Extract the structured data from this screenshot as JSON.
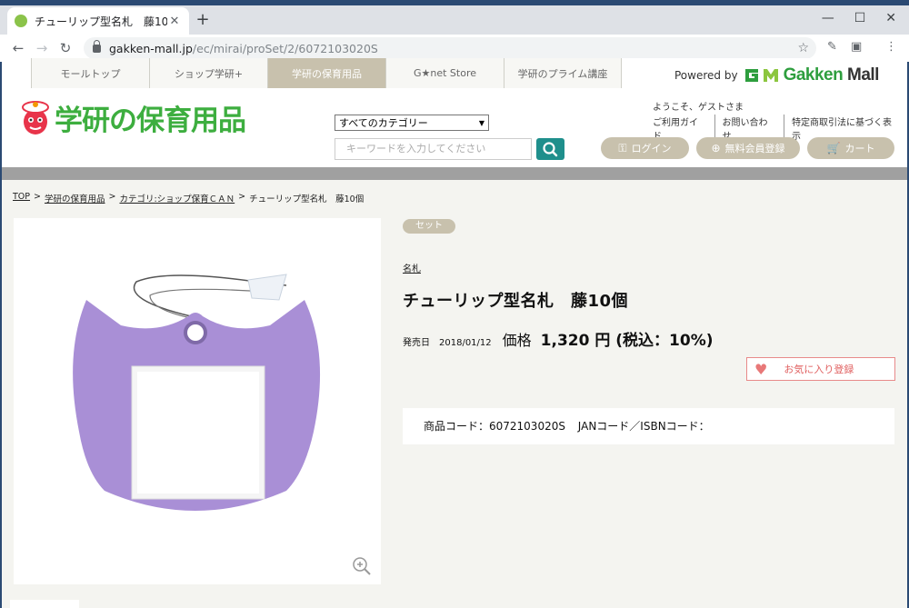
{
  "browser": {
    "tab_title": "チューリップ型名札　藤10個",
    "tab_close": "✕",
    "new_tab": "+",
    "url_host": "gakken-mall.jp",
    "url_path": "/ec/mirai/proSet/2/6072103020S",
    "controls": {
      "minimize": "—",
      "maximize": "☐",
      "close": "✕"
    }
  },
  "topnav": {
    "tabs": [
      "モールトップ",
      "ショップ学研+",
      "学研の保育用品",
      "G★net Store",
      "学研のプライム講座"
    ],
    "active_index": 2,
    "powered_by": "Powered by",
    "brand_gakken": "Gakken",
    "brand_mall": "Mall"
  },
  "header": {
    "logo_text": "学研の保育用品",
    "category_select": "すべてのカテゴリー",
    "search_placeholder": "キーワードを入力してください",
    "greeting": "ようこそ、ゲストさま",
    "util_links": [
      "ご利用ガイド",
      "お問い合わせ",
      "特定商取引法に基づく表示"
    ],
    "login": "ログイン",
    "register": "無料会員登録",
    "cart": "カート"
  },
  "breadcrumb": {
    "top": "TOP",
    "shop": "学研の保育用品",
    "category": "カテゴリ:ショップ保育ＣＡＮ",
    "current": "チューリップ型名札　藤10個",
    "sep": ">"
  },
  "product": {
    "badge": "セット",
    "category": "名札",
    "title": "チューリップ型名札　藤10個",
    "release_label": "発売日",
    "release_date": "2018/01/12",
    "price_label": "価格",
    "price": "1,320 円 (税込：10%)",
    "favorite": "お気に入り登録",
    "code_label": "商品コード：6072103020S",
    "jan_label": "JANコード／ISBNコード：",
    "image_color": "#a98fd6"
  },
  "colors": {
    "accent_beige": "#c8c1ad",
    "search_teal": "#1f8f8c",
    "logo_green": "#3dae3f"
  }
}
